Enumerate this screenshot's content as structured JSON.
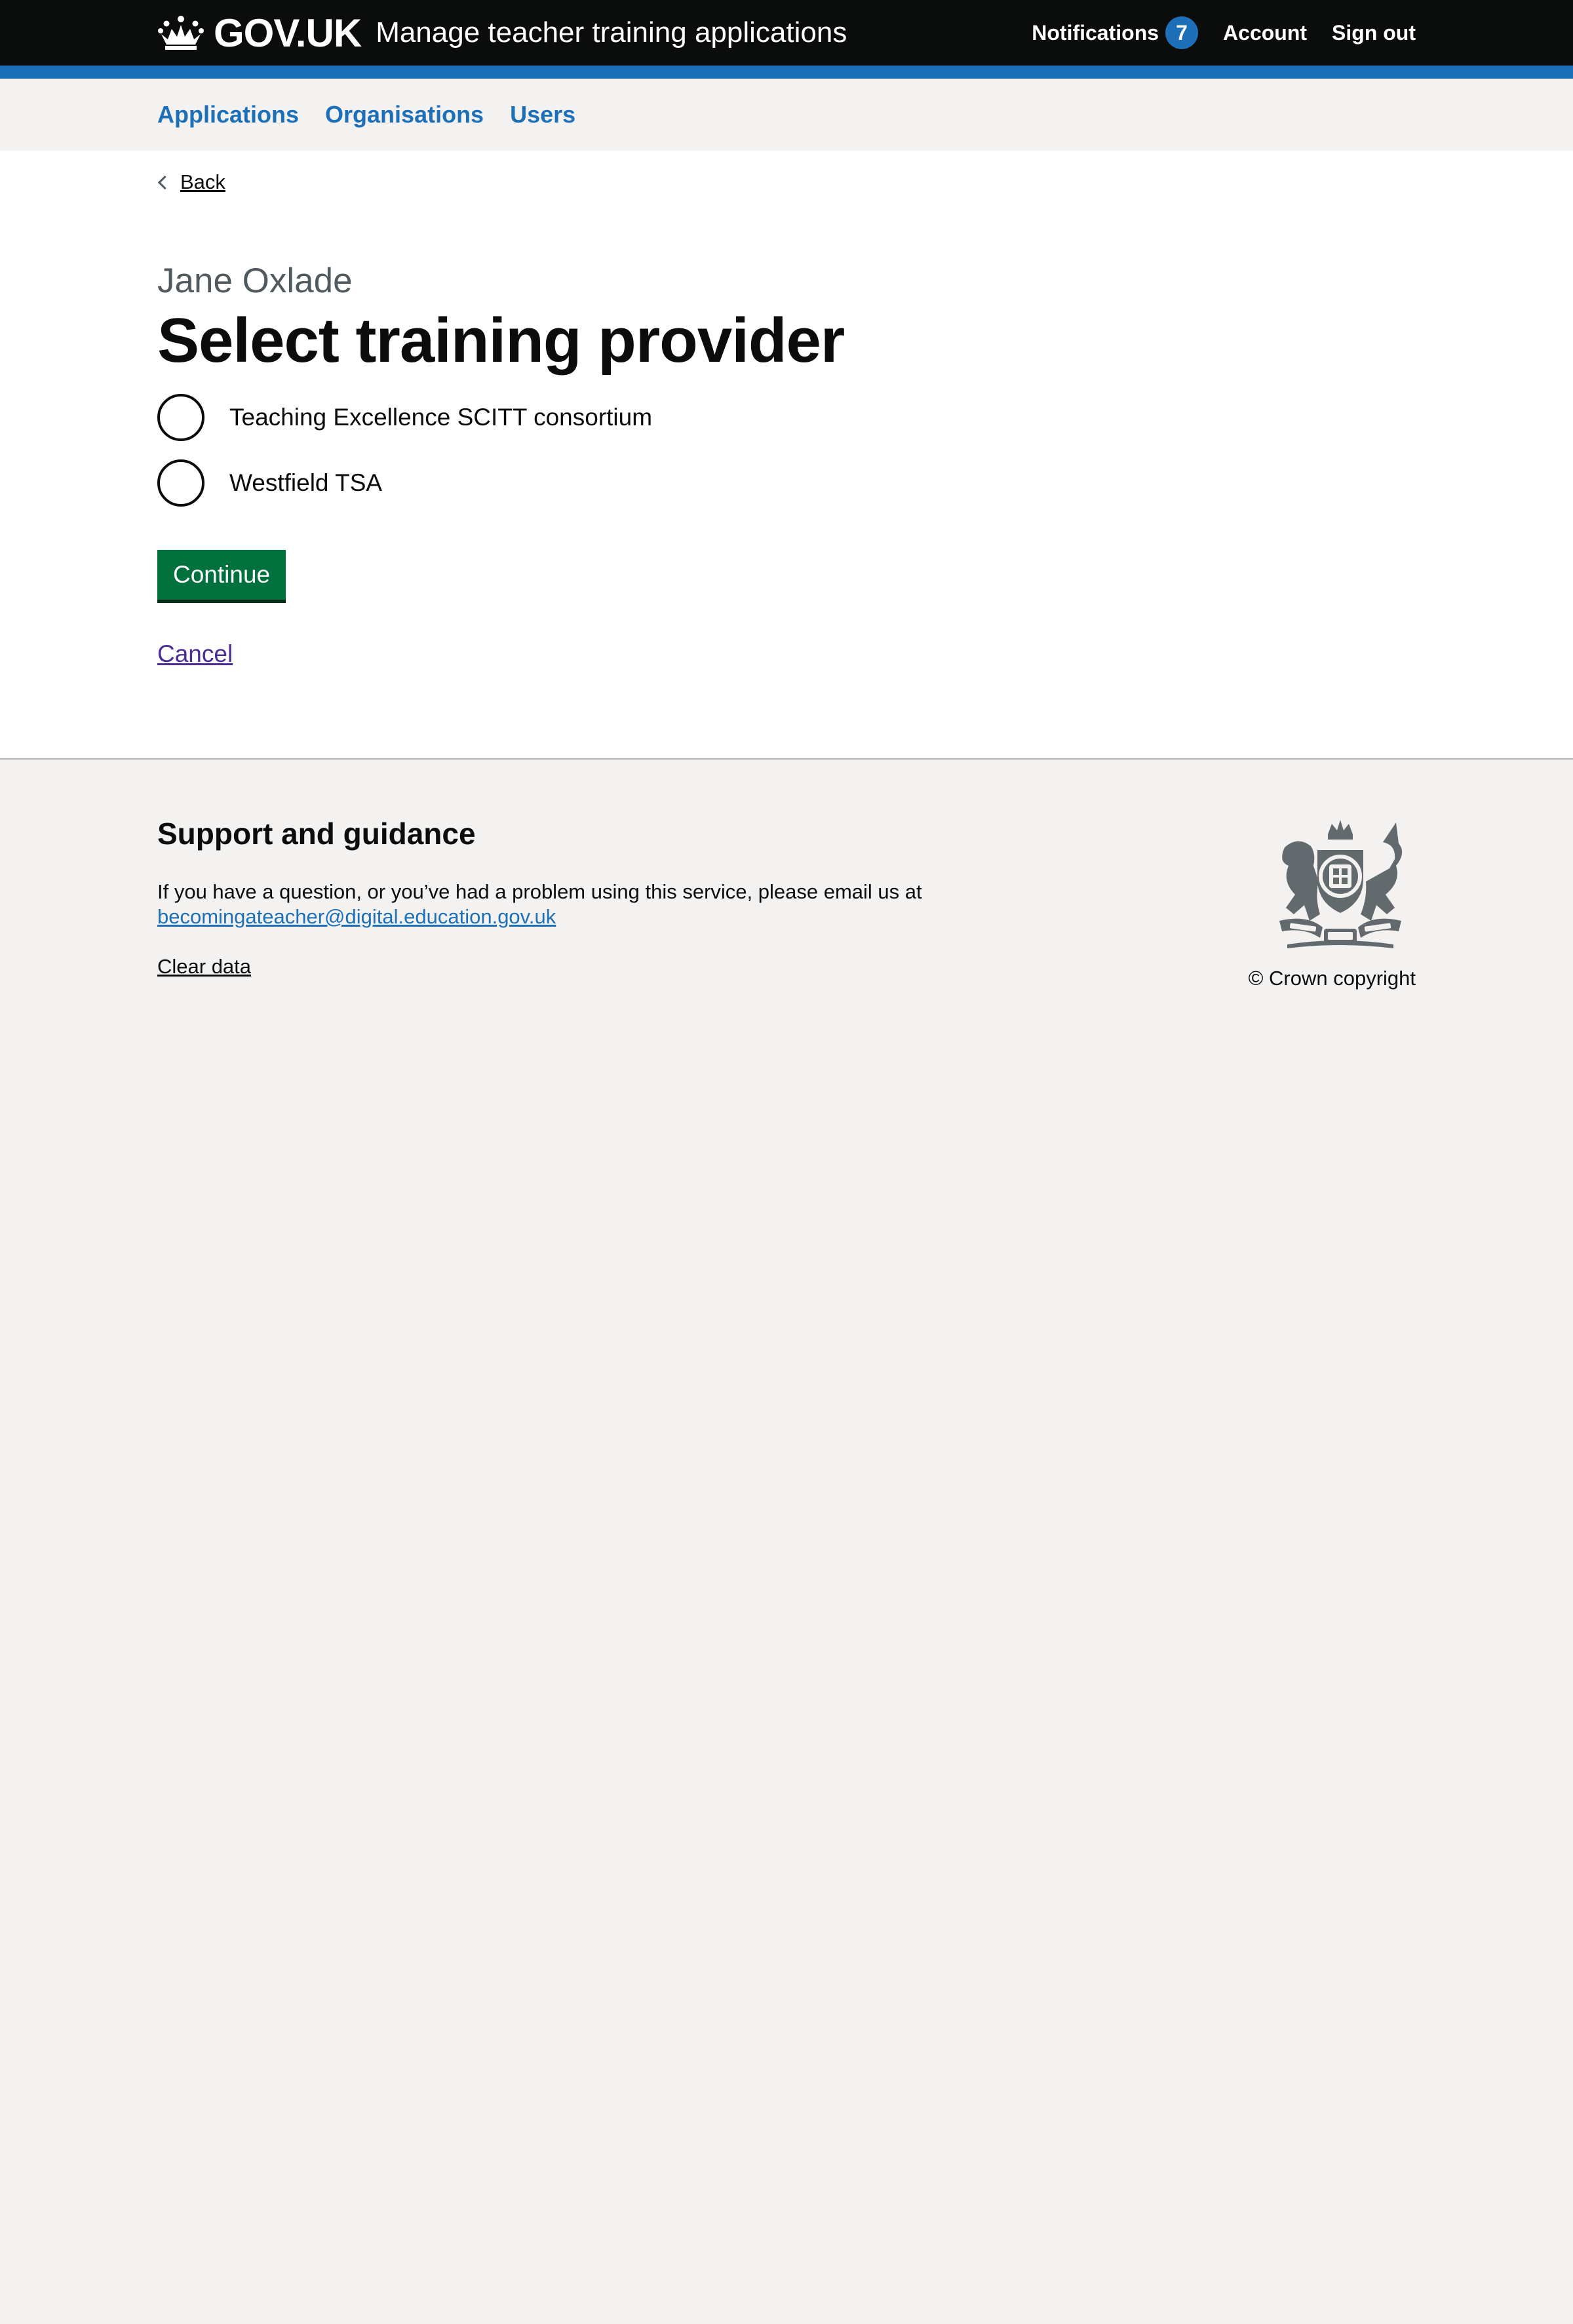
{
  "header": {
    "logo_text": "GOV.UK",
    "service_name": "Manage teacher training applications",
    "nav": {
      "notifications_label": "Notifications",
      "notifications_count": "7",
      "account_label": "Account",
      "signout_label": "Sign out"
    }
  },
  "primary_nav": {
    "items": [
      {
        "label": "Applications"
      },
      {
        "label": "Organisations"
      },
      {
        "label": "Users"
      }
    ]
  },
  "main": {
    "back_label": "Back",
    "caption": "Jane Oxlade",
    "title": "Select training provider",
    "options": [
      {
        "label": "Teaching Excellence SCITT consortium"
      },
      {
        "label": "Westfield TSA"
      }
    ],
    "continue_label": "Continue",
    "cancel_label": "Cancel"
  },
  "footer": {
    "heading": "Support and guidance",
    "help_text": "If you have a question, or you’ve had a problem using this service, please email us at",
    "email": "becomingateacher@digital.education.gov.uk",
    "clear_data_label": "Clear data",
    "copyright": "© Crown copyright",
    "crest_text": [
      "HONI SOIT QUI MAL Y PENSE",
      "DIEU",
      "ET MON",
      "DROIT"
    ]
  },
  "colors": {
    "header_bg": "#0b0c0c",
    "brand_blue": "#1d70b8",
    "button_green": "#00703c",
    "visited_link": "#4c2c92",
    "page_bg": "#f3f2f1"
  },
  "icons": {
    "crown": "crown-icon",
    "back": "chevron-left-icon",
    "crest": "royal-coat-of-arms"
  }
}
